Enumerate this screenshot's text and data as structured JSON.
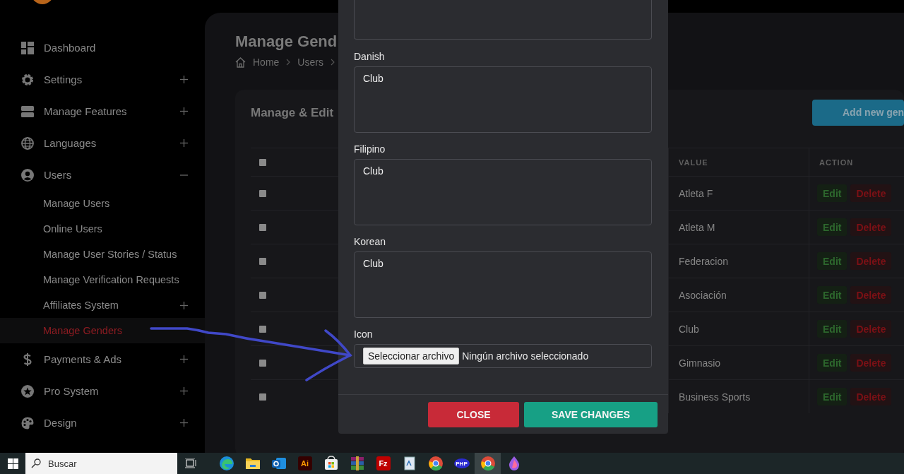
{
  "sidebar": {
    "items": [
      {
        "label": "Dashboard",
        "selected": false
      },
      {
        "label": "Settings",
        "expanded": false,
        "selected": false
      },
      {
        "label": "Manage Features",
        "expanded": false,
        "selected": false
      },
      {
        "label": "Languages",
        "expanded": false,
        "selected": false
      },
      {
        "label": "Users",
        "expanded": true,
        "selected": false,
        "children": [
          {
            "label": "Manage Users",
            "selected": false
          },
          {
            "label": "Online Users",
            "selected": false
          },
          {
            "label": "Manage User Stories / Status",
            "selected": false
          },
          {
            "label": "Manage Verification Requests",
            "selected": false
          },
          {
            "label": "Affiliates System",
            "expanded": false,
            "selected": false
          },
          {
            "label": "Manage Genders",
            "selected": true
          }
        ]
      },
      {
        "label": "Payments & Ads",
        "expanded": false,
        "selected": false
      },
      {
        "label": "Pro System",
        "expanded": false,
        "selected": false
      },
      {
        "label": "Design",
        "expanded": false,
        "selected": false
      }
    ]
  },
  "page": {
    "title": "Manage Gend",
    "breadcrumb": [
      "Home",
      "Users"
    ]
  },
  "card": {
    "title": "Manage & Edit",
    "add_button": "Add new gen"
  },
  "table": {
    "header_checked": false,
    "columns": [
      "VALUE",
      "ACTION"
    ],
    "rows": [
      {
        "checked": false,
        "value": "Atleta F",
        "edit": "Edit",
        "delete": "Delete"
      },
      {
        "checked": false,
        "value": "Atleta M",
        "edit": "Edit",
        "delete": "Delete"
      },
      {
        "checked": false,
        "value": "Federacion",
        "edit": "Edit",
        "delete": "Delete"
      },
      {
        "checked": false,
        "value": "Asociación",
        "edit": "Edit",
        "delete": "Delete"
      },
      {
        "checked": false,
        "value": "Club",
        "edit": "Edit",
        "delete": "Delete"
      },
      {
        "checked": false,
        "value": "Gimnasio",
        "edit": "Edit",
        "delete": "Delete"
      },
      {
        "checked": false,
        "value": "Business Sports",
        "edit": "Edit",
        "delete": "Delete"
      }
    ]
  },
  "modal": {
    "fields": [
      {
        "kind": "textarea"
      },
      {
        "kind": "textarea",
        "label": "Danish",
        "value": "Club"
      },
      {
        "kind": "textarea",
        "label": "Filipino",
        "value": "Club"
      },
      {
        "kind": "textarea",
        "label": "Korean",
        "value": "Club"
      },
      {
        "kind": "file",
        "label": "Icon",
        "button": "Seleccionar archivo",
        "status": "Ningún archivo seleccionado"
      }
    ],
    "buttons": [
      {
        "label": "CLOSE",
        "kind": "danger"
      },
      {
        "label": "SAVE CHANGES",
        "kind": "primary"
      }
    ]
  },
  "taskbar": {
    "search_placeholder": "Buscar",
    "apps": [
      {
        "kind": "edge",
        "selected": false
      },
      {
        "kind": "folder",
        "selected": false
      },
      {
        "kind": "mail",
        "selected": false
      },
      {
        "kind": "ai",
        "label": "Ai",
        "selected": false
      },
      {
        "kind": "store",
        "selected": false
      },
      {
        "kind": "archive",
        "selected": false
      },
      {
        "kind": "fz",
        "label": "Fz",
        "selected": false
      },
      {
        "kind": "doc",
        "selected": false
      },
      {
        "kind": "chrome",
        "selected": false
      },
      {
        "kind": "php",
        "label": "PHP",
        "selected": false
      },
      {
        "kind": "chrome",
        "selected": true
      },
      {
        "kind": "drop",
        "selected": false
      }
    ]
  }
}
